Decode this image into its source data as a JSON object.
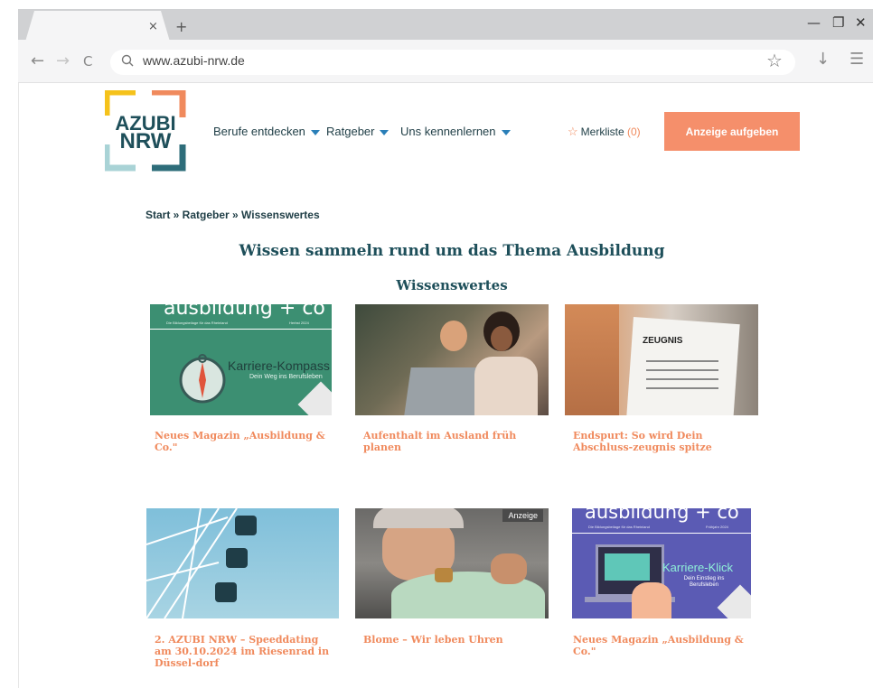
{
  "browser": {
    "tab_close": "×",
    "new_tab": "+",
    "url": "www.azubi-nrw.de",
    "controls": {
      "minimize": "—",
      "restore": "❐",
      "close": "✕"
    },
    "nav": {
      "back": "←",
      "forward": "→",
      "reload": "C"
    }
  },
  "site": {
    "logo": {
      "line1": "AZUBI",
      "line2": "NRW",
      "colors": {
        "yellow": "#f5c21b",
        "orange": "#f08a5d",
        "teal": "#2e6d7a",
        "light": "#a9d3d6"
      }
    },
    "nav_items": [
      "Berufe entdecken",
      "Ratgeber",
      "Uns kennenlernen"
    ],
    "merkliste_label": "Merkliste",
    "merkliste_count": "(0)",
    "cta_label": "Anzeige aufgeben",
    "accent_color": "#f58f6b"
  },
  "breadcrumb": "Start » Ratgeber » Wissenswertes",
  "page_title": "Wissen sammeln rund um das Thema Ausbildung",
  "section_title": "Wissenswertes",
  "cards": [
    {
      "title": "Neues Magazin „Ausbildung & Co.\"",
      "image": {
        "brand": "ausbildung + co",
        "tagline": "Die Bildungsbeilage für das Rheinland",
        "season": "Herbst 2024",
        "headline": "Karriere-Kompass",
        "subline": "Dein Weg ins Berufsleben"
      }
    },
    {
      "title": "Aufenthalt im Ausland früh planen",
      "image": {
        "scene": "two-people-laptop"
      }
    },
    {
      "title": "Endspurt: So wird Dein Abschluss-zeugnis spitze",
      "image": {
        "document_label": "ZEUGNIS"
      }
    },
    {
      "title": "2. AZUBI NRW – Speeddating am 30.10.2024 im Riesenrad in Düssel-dorf",
      "image": {
        "scene": "ferris-wheel"
      }
    },
    {
      "title": "Blome – Wir leben Uhren",
      "badge": "Anzeige",
      "image": {
        "scene": "watchmaker"
      }
    },
    {
      "title": "Neues Magazin „Ausbildung & Co.\"",
      "image": {
        "brand": "ausbildung + co",
        "tagline": "Die Bildungsbeilage für das Rheinland",
        "season": "Frühjahr 2024",
        "headline": "Karriere-Klick",
        "subline": "Dein Einstieg ins Berufsleben"
      }
    }
  ]
}
